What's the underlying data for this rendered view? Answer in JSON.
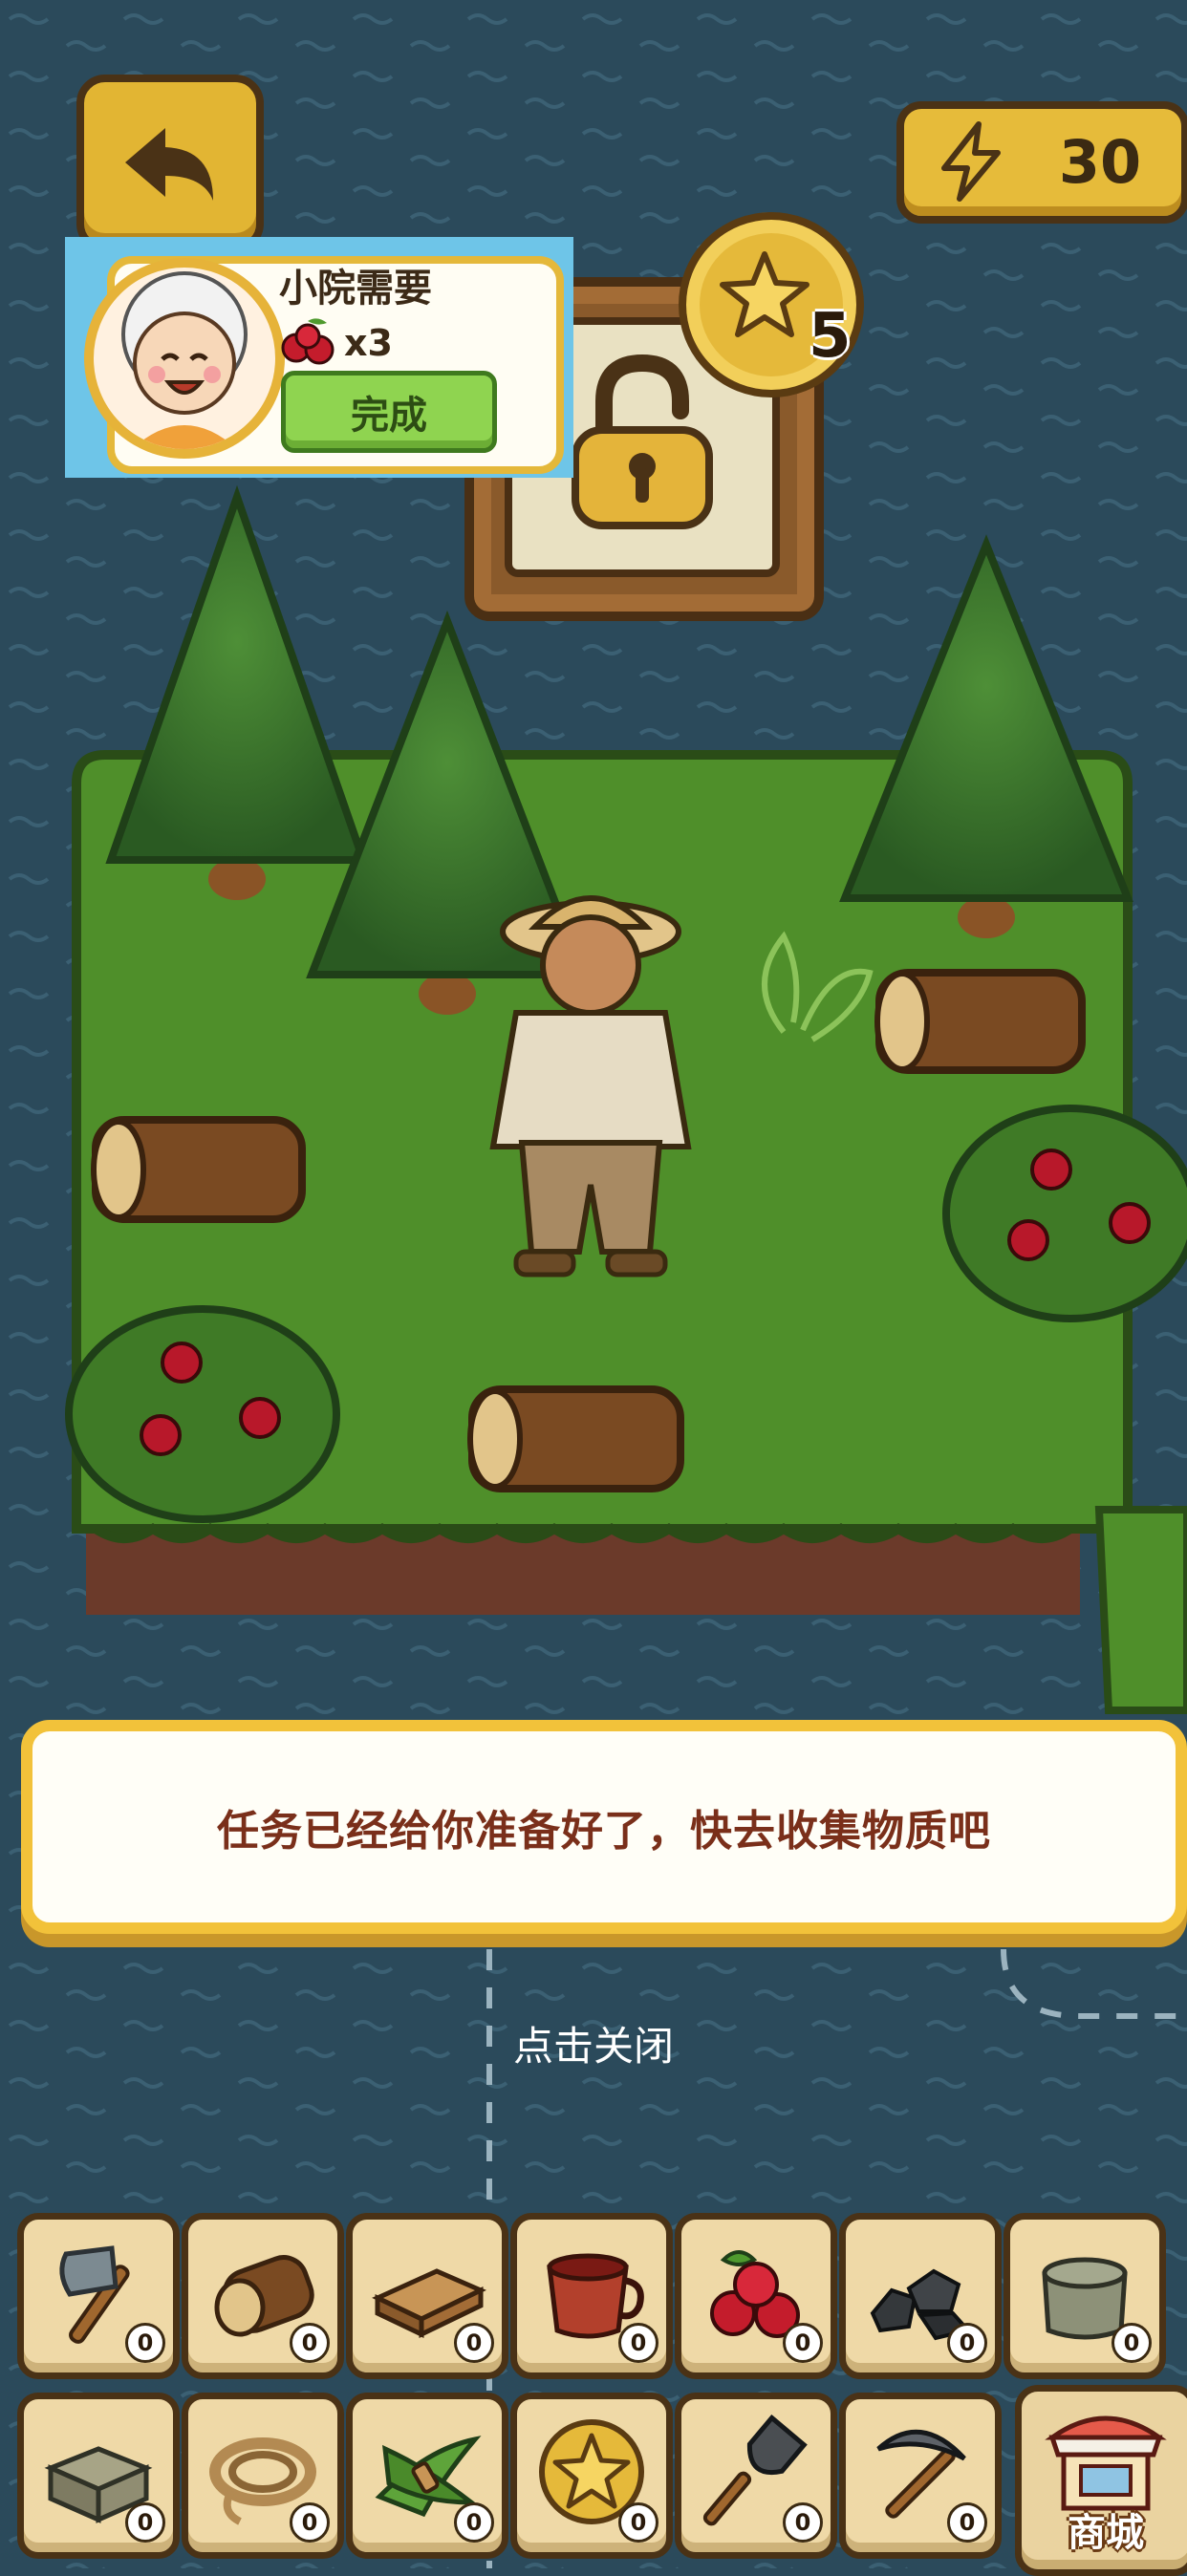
{
  "top_bar": {
    "back_icon": "back-arrow-icon",
    "energy_icon": "lightning-icon",
    "energy_value": "30"
  },
  "task": {
    "title": "小院需要",
    "item_icon": "cherry-icon",
    "item_count": "x3",
    "complete_label": "完成"
  },
  "unlock": {
    "icon": "padlock-open-icon",
    "cost_icon": "star-coin-icon",
    "cost": "5"
  },
  "dialog": {
    "message": "任务已经给你准备好了，快去收集物质吧",
    "close_hint": "点击关闭"
  },
  "inventory": {
    "row1": [
      {
        "icon": "axe-icon",
        "count": "0"
      },
      {
        "icon": "log-icon",
        "count": "0"
      },
      {
        "icon": "plank-icon",
        "count": "0"
      },
      {
        "icon": "cup-icon",
        "count": "0"
      },
      {
        "icon": "berries-icon",
        "count": "0"
      },
      {
        "icon": "coal-icon",
        "count": "0"
      },
      {
        "icon": "stone-icon",
        "count": "0"
      }
    ],
    "row2": [
      {
        "icon": "stone-block-icon",
        "count": "0"
      },
      {
        "icon": "rope-icon",
        "count": "0"
      },
      {
        "icon": "grass-bundle-icon",
        "count": "0"
      },
      {
        "icon": "star-coin-icon",
        "count": "0"
      },
      {
        "icon": "shovel-icon",
        "count": "0"
      },
      {
        "icon": "pickaxe-icon",
        "count": "0"
      }
    ],
    "shop_label": "商城",
    "shop_icon": "shop-stall-icon"
  },
  "colors": {
    "water": "#2b4a5b",
    "grass": "#4f8f2a",
    "gold": "#e6bb3a",
    "dialog_text": "#7a2f1a"
  }
}
